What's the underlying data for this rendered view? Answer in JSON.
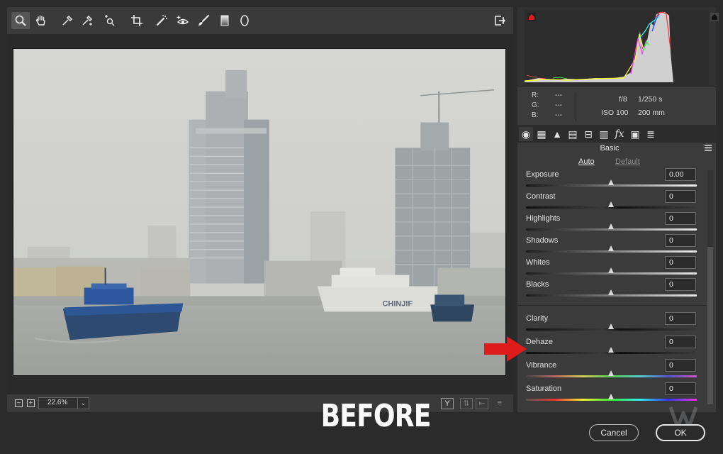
{
  "toolbar": {
    "tools": [
      "zoom-icon",
      "hand-icon",
      "white-balance-icon",
      "color-sampler-icon",
      "targeted-adjustment-icon",
      "crop-icon",
      "spot-removal-icon",
      "red-eye-icon",
      "adjustment-brush-icon",
      "graduated-filter-icon",
      "radial-filter-icon"
    ],
    "active_tool": "zoom-icon",
    "export_icon": "export-icon"
  },
  "status_bar": {
    "zoom_value": "22.6%",
    "before_after_label": "Y"
  },
  "histogram": {
    "shadow_clipping_icon": "shadow-clip-warning-icon",
    "highlight_clipping_icon": "highlight-clip-warning-icon"
  },
  "info": {
    "r_label": "R:",
    "r_value": "---",
    "g_label": "G:",
    "g_value": "---",
    "b_label": "B:",
    "b_value": "---",
    "aperture": "f/8",
    "shutter": "1/250 s",
    "iso": "ISO 100",
    "focal_length": "200 mm"
  },
  "panel": {
    "title": "Basic",
    "auto_label": "Auto",
    "default_label": "Default",
    "sliders": [
      {
        "label": "Exposure",
        "value": "0.00"
      },
      {
        "label": "Contrast",
        "value": "0"
      },
      {
        "label": "Highlights",
        "value": "0"
      },
      {
        "label": "Shadows",
        "value": "0"
      },
      {
        "label": "Whites",
        "value": "0"
      },
      {
        "label": "Blacks",
        "value": "0"
      },
      {
        "label": "Clarity",
        "value": "0"
      },
      {
        "label": "Dehaze",
        "value": "0"
      },
      {
        "label": "Vibrance",
        "value": "0"
      },
      {
        "label": "Saturation",
        "value": "0"
      }
    ]
  },
  "overlay": {
    "before_label": "BEFORE"
  },
  "dialog": {
    "cancel_label": "Cancel",
    "ok_label": "OK"
  },
  "photo": {
    "ship_lettering": "CHINJIF"
  },
  "colors": {
    "accent_red": "#e01b1b",
    "panel_bg": "#3b3b3b",
    "app_bg": "#2b2b2b"
  }
}
